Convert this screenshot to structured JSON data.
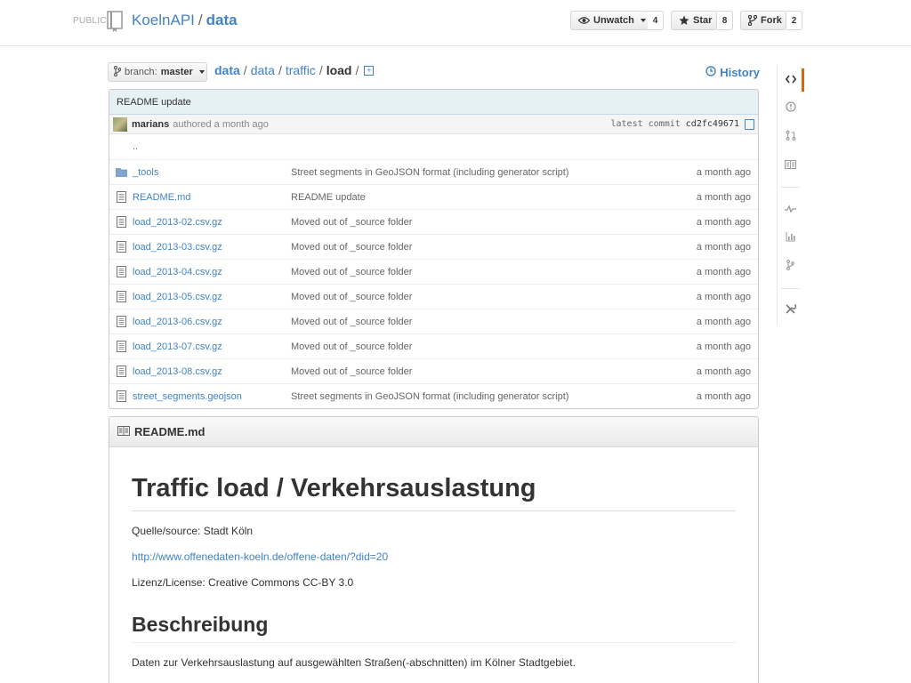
{
  "header": {
    "visibility": "PUBLIC",
    "owner": "KoelnAPI",
    "separator": "/",
    "repo": "data",
    "buttons": [
      {
        "icon": "eye-icon",
        "label": "Unwatch",
        "count": "4"
      },
      {
        "icon": "star-icon",
        "label": "Star",
        "count": "8"
      },
      {
        "icon": "fork-icon",
        "label": "Fork",
        "count": "2"
      }
    ]
  },
  "branch": {
    "prefix": "branch:",
    "name": "master"
  },
  "breadcrumb": {
    "root": "data",
    "parts": [
      "data",
      "traffic"
    ],
    "current": "load",
    "sep": "/",
    "add_file": "+"
  },
  "history_label": "History",
  "commit": {
    "message": "README update",
    "author": "marians",
    "authored": "authored a month ago",
    "latest_label": "latest commit",
    "sha": "cd2fc49671"
  },
  "files": {
    "up": "..",
    "rows": [
      {
        "type": "dir",
        "name": "_tools",
        "message": "Street segments in GeoJSON format (including generator script)",
        "age": "a month ago"
      },
      {
        "type": "file",
        "name": "README.md",
        "message": "README update",
        "age": "a month ago"
      },
      {
        "type": "file",
        "name": "load_2013-02.csv.gz",
        "message": "Moved out of _source folder",
        "age": "a month ago"
      },
      {
        "type": "file",
        "name": "load_2013-03.csv.gz",
        "message": "Moved out of _source folder",
        "age": "a month ago"
      },
      {
        "type": "file",
        "name": "load_2013-04.csv.gz",
        "message": "Moved out of _source folder",
        "age": "a month ago"
      },
      {
        "type": "file",
        "name": "load_2013-05.csv.gz",
        "message": "Moved out of _source folder",
        "age": "a month ago"
      },
      {
        "type": "file",
        "name": "load_2013-06.csv.gz",
        "message": "Moved out of _source folder",
        "age": "a month ago"
      },
      {
        "type": "file",
        "name": "load_2013-07.csv.gz",
        "message": "Moved out of _source folder",
        "age": "a month ago"
      },
      {
        "type": "file",
        "name": "load_2013-08.csv.gz",
        "message": "Moved out of _source folder",
        "age": "a month ago"
      },
      {
        "type": "file",
        "name": "street_segments.geojson",
        "message": "Street segments in GeoJSON format (including generator script)",
        "age": "a month ago"
      }
    ]
  },
  "readme": {
    "filename": "README.md",
    "h1": "Traffic load / Verkehrsauslastung",
    "source": "Quelle/source: Stadt Köln",
    "link": "http://www.offenedaten-koeln.de/offene-daten/?did=20",
    "license": "Lizenz/License: Creative Commons CC-BY 3.0",
    "h2": "Beschreibung",
    "description": "Daten zur Verkehrsauslastung auf ausgewählten Straßen(-abschnitten) im Kölner Stadtgebiet."
  },
  "sidenav": [
    "code-icon",
    "issues-icon",
    "pull-requests-icon",
    "wiki-icon",
    "pulse-icon",
    "graphs-icon",
    "network-icon",
    "settings-icon"
  ],
  "colors": {
    "link": "#4183c4",
    "selected": "#d26911",
    "commit_bg": "#e6f1f6"
  }
}
